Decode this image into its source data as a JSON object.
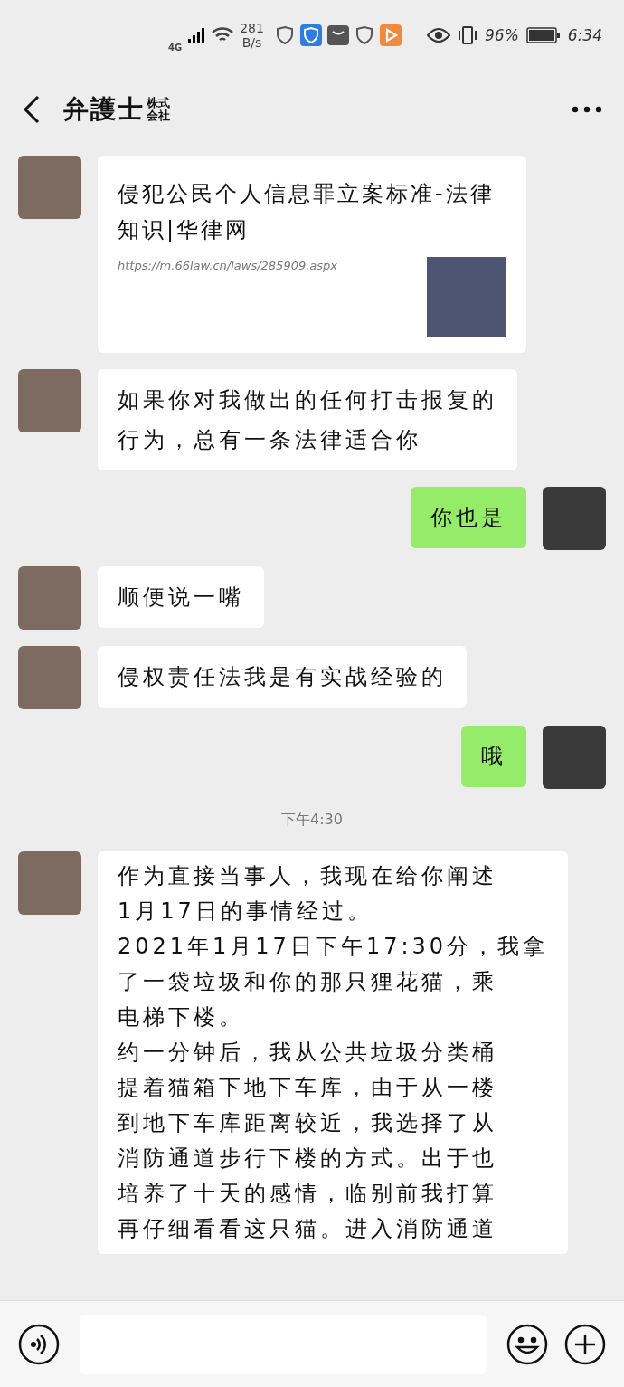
{
  "status_bar": {
    "network": "4G",
    "speed": "281",
    "speed_unit": "B/s",
    "battery": "96%",
    "time": "6:34"
  },
  "header": {
    "title": "弁護士",
    "title_mark": "株式会社"
  },
  "messages": [
    {
      "kind": "link",
      "outgoing": false,
      "title": "侵犯公民个人信息罪立案标准-法律知识|华律网",
      "url": "https://m.66law.cn/laws/285909.aspx"
    },
    {
      "kind": "text",
      "outgoing": false,
      "lines": [
        "如果你对我做出的任何打击报复的",
        "行为，总有一条法律适合你"
      ]
    },
    {
      "kind": "text",
      "outgoing": true,
      "lines": [
        "你也是"
      ]
    },
    {
      "kind": "text",
      "outgoing": false,
      "lines": [
        "顺便说一嘴"
      ]
    },
    {
      "kind": "text",
      "outgoing": false,
      "lines": [
        "侵权责任法我是有实战经验的"
      ]
    },
    {
      "kind": "text",
      "outgoing": true,
      "lines": [
        "哦"
      ]
    },
    {
      "kind": "time",
      "text": "下午4:30"
    },
    {
      "kind": "text",
      "outgoing": false,
      "lines": [
        "作为直接当事人，我现在给你阐述",
        "1月17日的事情经过。",
        "2021年1月17日下午17:30分，我拿",
        "了一袋垃圾和你的那只狸花猫，乘",
        "电梯下楼。",
        "约一分钟后，我从公共垃圾分类桶",
        "提着猫箱下地下车库，由于从一楼",
        "到地下车库距离较近，我选择了从",
        "消防通道步行下楼的方式。出于也",
        "培养了十天的感情，临别前我打算",
        "再仔细看看这只猫。进入消防通道"
      ]
    }
  ]
}
